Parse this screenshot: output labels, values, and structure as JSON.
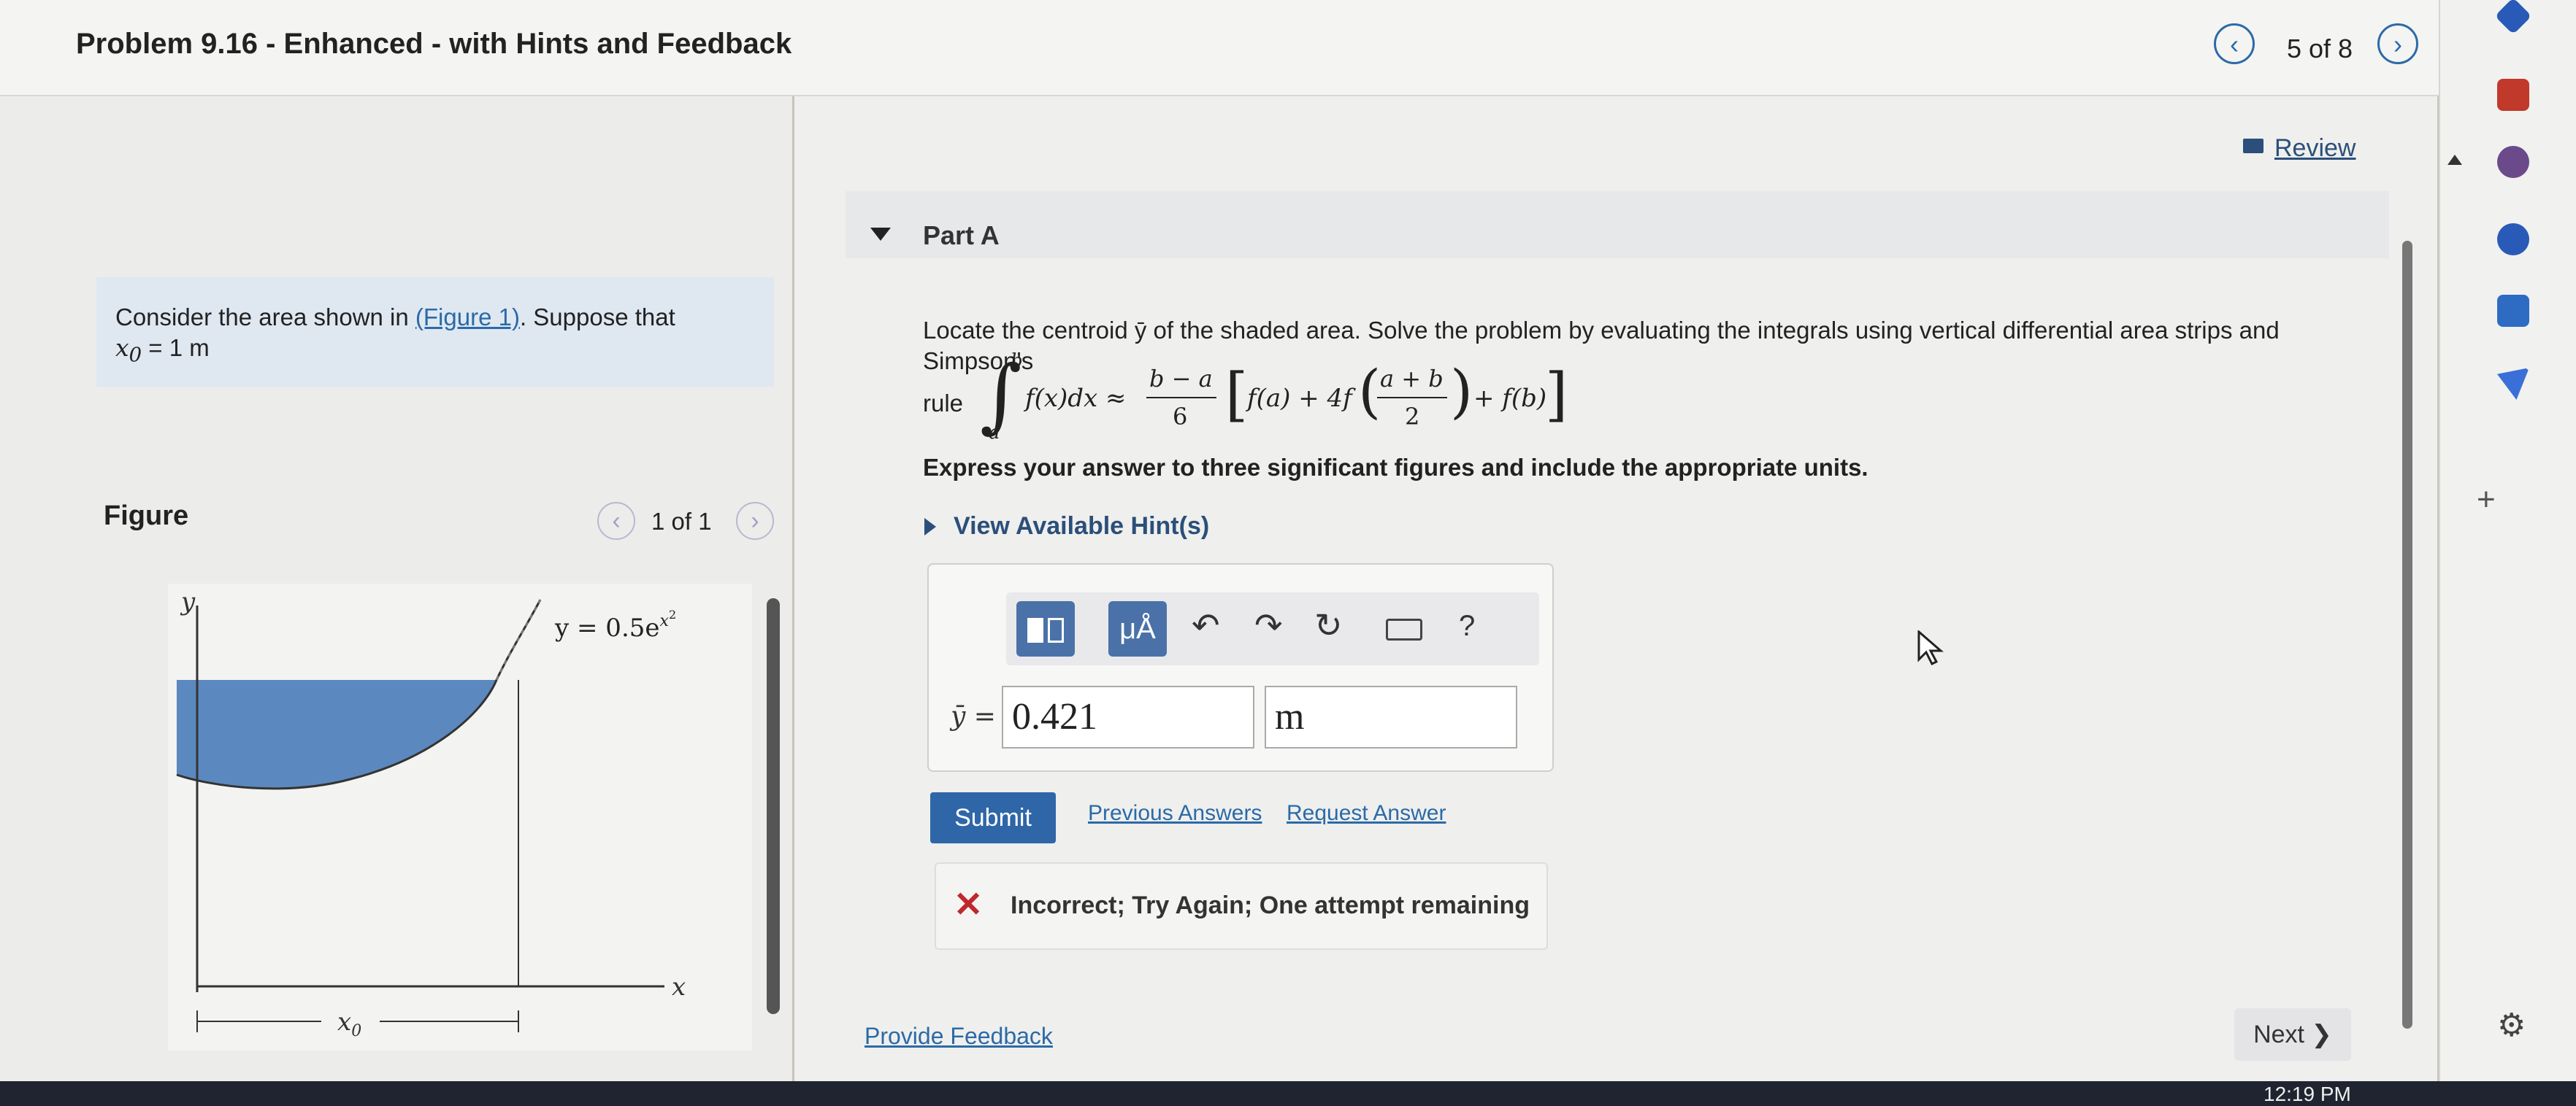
{
  "header": {
    "title": "Problem 9.16 - Enhanced - with Hints and Feedback",
    "pager": "5 of 8"
  },
  "review": "Review",
  "problem": {
    "text_before": "Consider the area shown in ",
    "figure_link": "(Figure 1)",
    "text_after": ". Suppose that",
    "x0": "x",
    "x0_sub": "0",
    "x0_value": " = 1 m"
  },
  "figure": {
    "label": "Figure",
    "pager": "1 of 1",
    "y_axis": "y",
    "x_axis": "x",
    "x0_label": "x",
    "x0_sub": "0",
    "curve_label": "y = 0.5e",
    "curve_exp": "x",
    "curve_exp2": "2"
  },
  "part": {
    "label": "Part A",
    "question": "Locate the centroid ȳ of the shaded area. Solve the problem by evaluating the integrals using vertical differential area strips and Simpson's",
    "rule_word": "rule",
    "express": "Express your answer to three significant figures and include the appropriate units.",
    "hints": "View Available Hint(s)"
  },
  "toolbar": {
    "template_icon": "template-icon",
    "units_label": "μÅ",
    "help": "?"
  },
  "answer": {
    "label": "ȳ =",
    "value": "0.421",
    "unit": "m"
  },
  "actions": {
    "submit": "Submit",
    "previous": "Previous Answers",
    "request": "Request Answer"
  },
  "feedback": {
    "message": "Incorrect; Try Again; One attempt remaining"
  },
  "footer": {
    "provide_feedback": "Provide Feedback",
    "next": "Next ❯"
  },
  "taskbar": {
    "time": "12:19 PM"
  },
  "colors": {
    "accent": "#2b6aa8",
    "submit": "#2f66a8",
    "shaded": "#5b88bf",
    "error": "#c0282d"
  }
}
